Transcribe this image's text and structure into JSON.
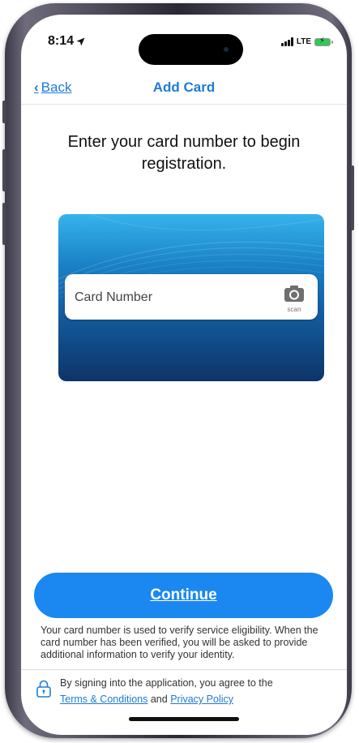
{
  "status_bar": {
    "time": "8:14",
    "network": "LTE"
  },
  "nav": {
    "back_label": "Back",
    "title": "Add Card"
  },
  "main": {
    "heading": "Enter your card number to begin registration.",
    "card_number_placeholder": "Card Number",
    "scan_label": "scan",
    "card_gradient_colors": [
      "#36b3ec",
      "#135a9c",
      "#0d3468"
    ]
  },
  "footer": {
    "continue_label": "Continue",
    "info_text": "Your card number is used to verify service eligibility. When the card number has been verified, you will be asked to provide additional information to verify your identity.",
    "legal_prefix": "By signing into the application, you agree to the",
    "terms_label": "Terms & Conditions",
    "legal_and": "and",
    "privacy_label": "Privacy Policy"
  },
  "colors": {
    "accent": "#1e7bd6",
    "button": "#1a88f0"
  }
}
